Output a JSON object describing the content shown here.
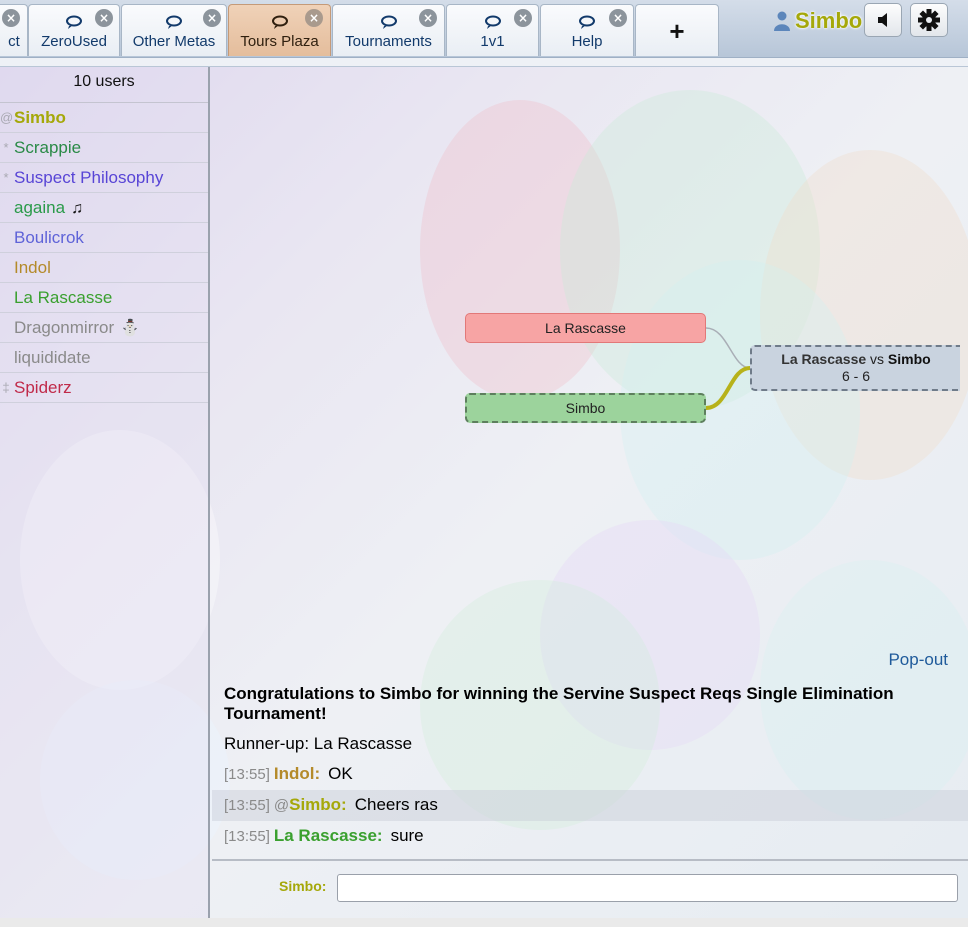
{
  "header": {
    "tabs": [
      {
        "label": "ct",
        "active": false
      },
      {
        "label": "ZeroUsed",
        "active": false
      },
      {
        "label": "Other Metas",
        "active": false
      },
      {
        "label": "Tours Plaza",
        "active": true
      },
      {
        "label": "Tournaments",
        "active": false
      },
      {
        "label": "1v1",
        "active": false
      },
      {
        "label": "Help",
        "active": false
      }
    ],
    "add_tab_label": "+",
    "user_name": "Simbo"
  },
  "userlist": {
    "count_label": "10 users",
    "users": [
      {
        "rank": "@",
        "name": "Simbo",
        "color": "#a5a80a",
        "bold": true,
        "extra": ""
      },
      {
        "rank": "*",
        "name": "Scrappie",
        "color": "#2a8a47",
        "bold": false,
        "extra": ""
      },
      {
        "rank": "*",
        "name": "Suspect Philosophy",
        "color": "#5845d6",
        "bold": false,
        "extra": ""
      },
      {
        "rank": "",
        "name": "againa",
        "color": "#2a9a4a",
        "bold": false,
        "extra": "♫"
      },
      {
        "rank": "",
        "name": "Boulicrok",
        "color": "#5f63d8",
        "bold": false,
        "extra": ""
      },
      {
        "rank": "",
        "name": "Indol",
        "color": "#b48a2a",
        "bold": false,
        "extra": ""
      },
      {
        "rank": "",
        "name": "La Rascasse",
        "color": "#3aa02f",
        "bold": false,
        "extra": ""
      },
      {
        "rank": "",
        "name": "Dragonmirror",
        "color": "#8a8a8a",
        "bold": false,
        "extra": "⛄"
      },
      {
        "rank": "",
        "name": "liquididate",
        "color": "#8a8a8a",
        "bold": false,
        "extra": ""
      },
      {
        "rank": "‡",
        "name": "Spiderz",
        "color": "#c02a4a",
        "bold": false,
        "extra": ""
      }
    ]
  },
  "bracket": {
    "player1": "La Rascasse",
    "player2": "Simbo",
    "match_p1": "La Rascasse",
    "match_vs": "vs",
    "match_p2": "Simbo",
    "match_score": "6 - 6"
  },
  "chat": {
    "popout_label": "Pop-out",
    "announcement": "Congratulations to Simbo for winning the Servine Suspect Reqs Single Elimination Tournament!",
    "runner_up": "Runner-up: La Rascasse",
    "messages": [
      {
        "time": "[13:55]",
        "prefix": "",
        "nick": "Indol:",
        "nick_color": "#b48a2a",
        "text": "OK",
        "highlight": false
      },
      {
        "time": "[13:55]",
        "prefix": "@",
        "nick": "Simbo:",
        "nick_color": "#a5a80a",
        "text": "Cheers ras",
        "highlight": true
      },
      {
        "time": "[13:55]",
        "prefix": "",
        "nick": "La Rascasse:",
        "nick_color": "#3aa02f",
        "text": "sure",
        "highlight": false
      }
    ],
    "input_label": "Simbo:",
    "input_value": ""
  },
  "colors": {
    "self_name": "#a5a80a",
    "active_tab": "#e4bd9c",
    "link": "#1f5a9b"
  },
  "icons": [
    "chat-bubble-icon",
    "close-icon",
    "plus-icon",
    "user-icon",
    "sound-icon",
    "gear-icon",
    "music-note-icon",
    "snowman-icon"
  ]
}
